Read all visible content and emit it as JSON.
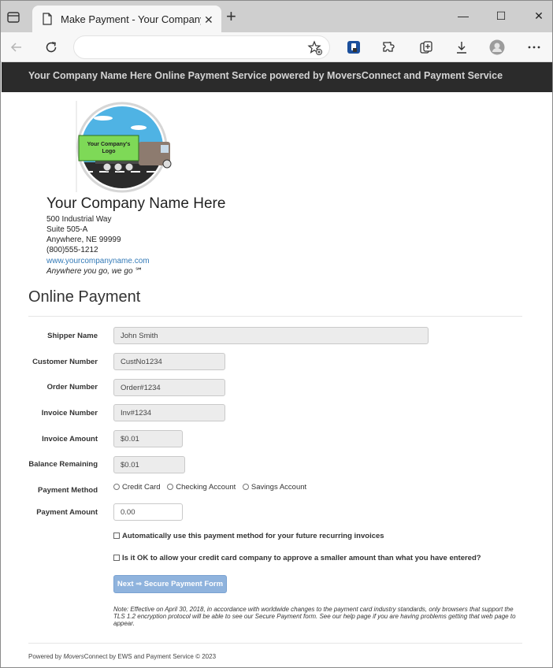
{
  "browser": {
    "tab_title": "Make Payment - Your Company N",
    "tab_close": "✕",
    "new_tab": "+",
    "window_minimize": "—",
    "window_maximize": "☐",
    "window_close": "✕",
    "address": ""
  },
  "site_header": {
    "text": "Your Company Name Here Online Payment Service powered by MoversConnect and Payment Service"
  },
  "company": {
    "logo_text_line1": "Your Company's",
    "logo_text_line2": "Logo",
    "name": "Your Company Name Here",
    "address1": "500 Industrial Way",
    "address2": "Suite 505-A",
    "city_state_zip": "Anywhere, NE 99999",
    "phone": "(800)555-1212",
    "website": "www.yourcompanyname.com",
    "tagline": "Anywhere you go, we go ℠"
  },
  "form": {
    "title": "Online Payment",
    "shipper_name": {
      "label": "Shipper Name",
      "value": "John Smith"
    },
    "customer_number": {
      "label": "Customer Number",
      "value": "CustNo1234"
    },
    "order_number": {
      "label": "Order Number",
      "value": "Order#1234"
    },
    "invoice_number": {
      "label": "Invoice Number",
      "value": "Inv#1234"
    },
    "invoice_amount": {
      "label": "Invoice Amount",
      "value": "$0.01"
    },
    "balance_remaining": {
      "label": "Balance Remaining",
      "value": "$0.01"
    },
    "payment_method": {
      "label": "Payment Method",
      "options": [
        "Credit Card",
        "Checking Account",
        "Savings Account"
      ]
    },
    "payment_amount": {
      "label": "Payment Amount",
      "value": "0.00"
    },
    "auto_recurring": "Automatically use this payment method for your future recurring invoices",
    "smaller_amount": "Is it OK to allow your credit card company to approve a smaller amount than what you have entered?",
    "next_button": "Next ⇒ Secure Payment Form",
    "note": "Note: Effective on April 30, 2018, in accordance with worldwide changes to the payment card industry standards, only browsers that support the TLS 1.2 encryption protocol will be able to see our Secure Payment form. See our help page if you are having problems getting that web page to appear."
  },
  "footer": {
    "prefix": "Powered by ",
    "brand_movers": "Movers",
    "suffix": "Connect by EWS and Payment Service © 2023"
  }
}
